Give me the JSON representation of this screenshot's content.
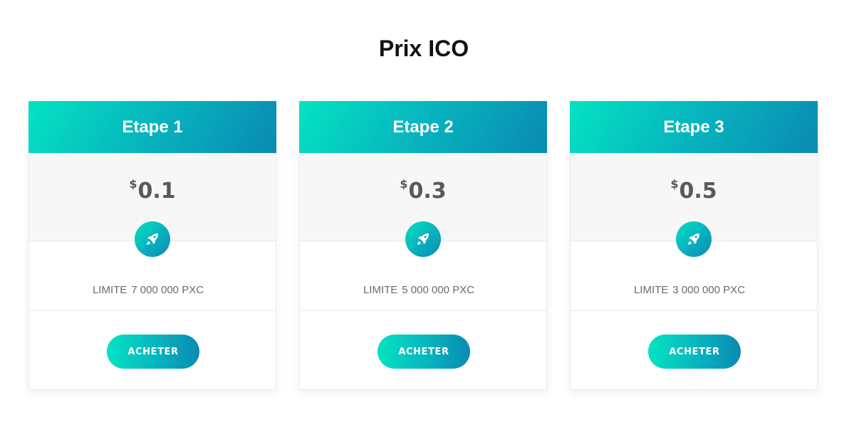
{
  "page": {
    "title": "Prix ICO"
  },
  "colors": {
    "gradient_start": "#04e3c2",
    "gradient_end": "#0a8ab3",
    "price_area_bg": "#f7f7f7",
    "text_muted": "#666b70"
  },
  "cards": [
    {
      "stage": "Etape 1",
      "currency": "$",
      "price": "0.1",
      "icon": "rocket-icon",
      "limit_label": "LIMITE",
      "limit_value": "7 000 000 PXC",
      "button_label": "ACHETER"
    },
    {
      "stage": "Etape 2",
      "currency": "$",
      "price": "0.3",
      "icon": "rocket-icon",
      "limit_label": "LIMITE",
      "limit_value": "5 000 000 PXC",
      "button_label": "ACHETER"
    },
    {
      "stage": "Etape 3",
      "currency": "$",
      "price": "0.5",
      "icon": "rocket-icon",
      "limit_label": "LIMITE",
      "limit_value": "3 000 000 PXC",
      "button_label": "ACHETER"
    }
  ]
}
